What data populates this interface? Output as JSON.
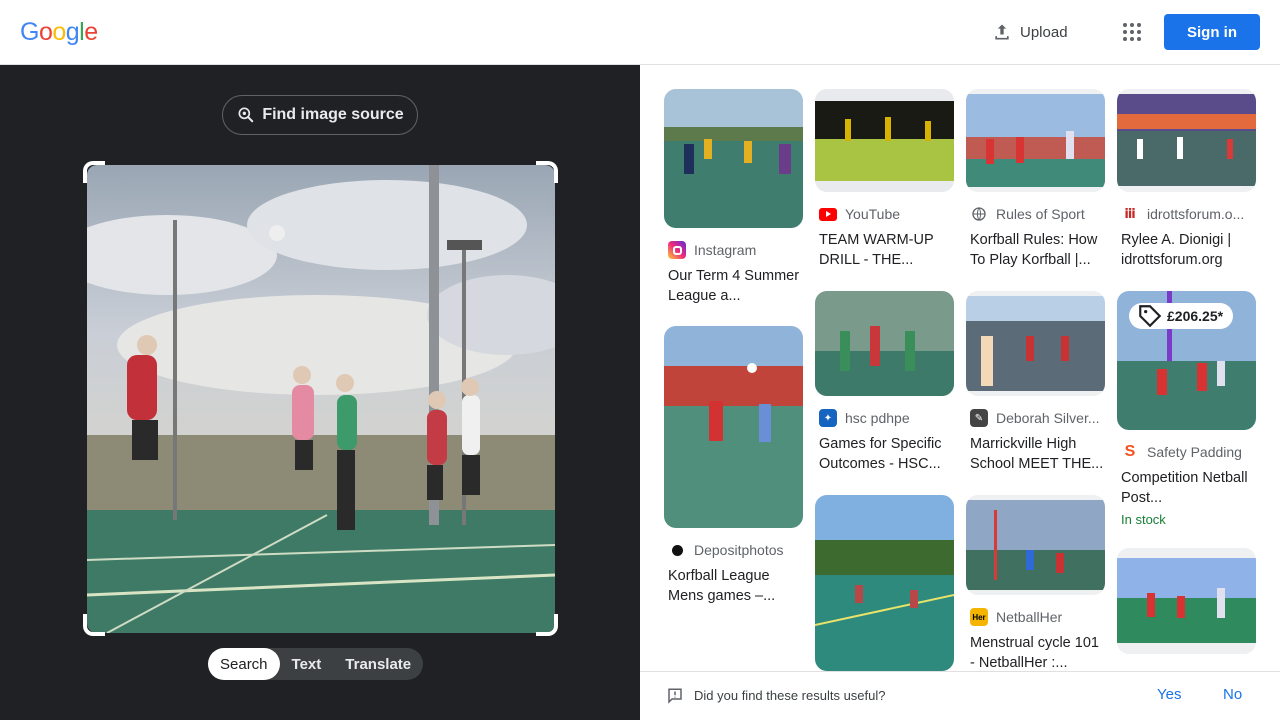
{
  "header": {
    "logo_letters": [
      {
        "ch": "G",
        "color": "#4285F4"
      },
      {
        "ch": "o",
        "color": "#EA4335"
      },
      {
        "ch": "o",
        "color": "#FBBC05"
      },
      {
        "ch": "g",
        "color": "#4285F4"
      },
      {
        "ch": "l",
        "color": "#34A853"
      },
      {
        "ch": "e",
        "color": "#EA4335"
      }
    ],
    "upload_label": "Upload",
    "upload_icon": "upload-icon",
    "apps_icon": "apps-grid-icon",
    "signin_label": "Sign in"
  },
  "left": {
    "find_label": "Find image source",
    "find_icon": "lens-search-icon",
    "tabs": [
      "Search",
      "Text",
      "Translate"
    ],
    "active_tab": "Search"
  },
  "results": [
    {
      "source": "Instagram",
      "title": "Our Term 4 Summer League a...",
      "icon": "instagram-icon",
      "icon_color": "#d62976"
    },
    {
      "source": "Depositphotos",
      "title": "Korfball League Mens games –...",
      "icon": "depositphotos-icon",
      "icon_color": "#111111"
    },
    {
      "source": "YouTube",
      "title": "TEAM WARM-UP DRILL - THE...",
      "icon": "youtube-icon",
      "icon_color": "#ff0000"
    },
    {
      "source": "hsc pdhpe",
      "title": "Games for Specific Outcomes - HSC...",
      "icon": "hsc-icon",
      "icon_color": "#1565c0"
    },
    {
      "source": "Rules of Sport",
      "title": "Korfball Rules: How To Play Korfball |...",
      "icon": "globe-icon",
      "icon_color": "#5f6368"
    },
    {
      "source": "Deborah Silver...",
      "title": "Marrickville High School MEET THE...",
      "icon": "deborah-icon",
      "icon_color": "#444444"
    },
    {
      "source": "NetballHer",
      "title": "Menstrual cycle 101 - NetballHer :...",
      "icon": "netballher-icon",
      "icon_color": "#f4b400"
    },
    {
      "source": "idrottsforum.o...",
      "title": "Rylee A. Dionigi | idrottsforum.org",
      "icon": "idrottsforum-icon",
      "icon_color": "#c62828"
    },
    {
      "source": "Safety Padding",
      "title": "Competition Netball Post...",
      "icon": "safety-padding-icon",
      "icon_color": "#f4511e",
      "price": "£206.25*",
      "stock": "In stock"
    }
  ],
  "feedback": {
    "question": "Did you find these results useful?",
    "yes": "Yes",
    "no": "No",
    "icon": "feedback-icon"
  }
}
